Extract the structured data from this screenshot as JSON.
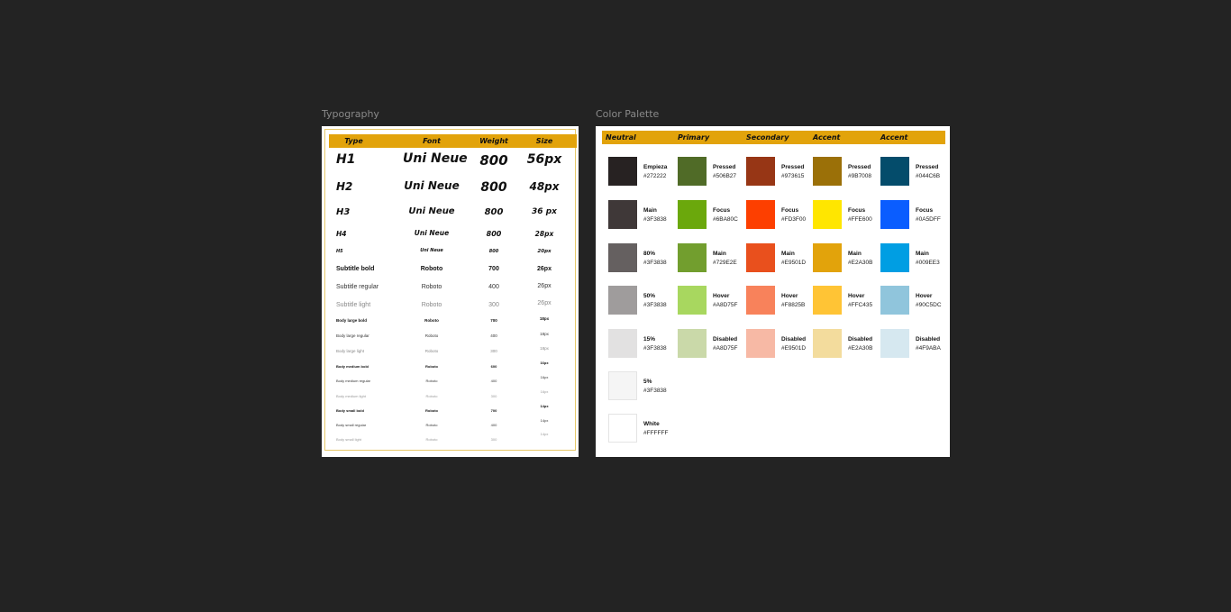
{
  "typography": {
    "frame_label": "Typography",
    "headers": [
      "Type",
      "Font",
      "Weight",
      "Size"
    ],
    "rows": [
      {
        "type": "H1",
        "font": "Uni Neue",
        "weight": "800",
        "size": "56px"
      },
      {
        "type": "H2",
        "font": "Uni Neue",
        "weight": "800",
        "size": "48px"
      },
      {
        "type": "H3",
        "font": "Uni Neue",
        "weight": "800",
        "size": "36 px"
      },
      {
        "type": "H4",
        "font": "Uni Neue",
        "weight": "800",
        "size": "28px"
      },
      {
        "type": "H5",
        "font": "Uni Neue",
        "weight": "800",
        "size": "20px"
      },
      {
        "type": "Subtitle bold",
        "font": "Roboto",
        "weight": "700",
        "size": "26px"
      },
      {
        "type": "Subtitle regular",
        "font": "Roboto",
        "weight": "400",
        "size": "26px"
      },
      {
        "type": "Subtitle light",
        "font": "Roboto",
        "weight": "300",
        "size": "26px"
      },
      {
        "type": "Body large bold",
        "font": "Roboto",
        "weight": "700",
        "size": "18px"
      },
      {
        "type": "Body large regular",
        "font": "Roboto",
        "weight": "400",
        "size": "18px"
      },
      {
        "type": "Body large light",
        "font": "Roboto",
        "weight": "300",
        "size": "18px"
      },
      {
        "type": "Body medium bold",
        "font": "Roboto",
        "weight": "600",
        "size": "16px"
      },
      {
        "type": "Body medium regular",
        "font": "Roboto",
        "weight": "400",
        "size": "16px"
      },
      {
        "type": "Body medium light",
        "font": "Roboto",
        "weight": "300",
        "size": "16px"
      },
      {
        "type": "Body small bold",
        "font": "Roboto",
        "weight": "700",
        "size": "14px"
      },
      {
        "type": "Body small regular",
        "font": "Roboto",
        "weight": "400",
        "size": "14px"
      },
      {
        "type": "Body small light",
        "font": "Roboto",
        "weight": "300",
        "size": "14px"
      }
    ]
  },
  "palette": {
    "frame_label": "Color Palette",
    "header_color": "#E2A30B",
    "columns": [
      {
        "title": "Neutral",
        "swatches": [
          {
            "name": "Empieza",
            "hex": "#272222",
            "color": "#272222"
          },
          {
            "name": "Main",
            "hex": "#3F3838",
            "color": "#3F3838"
          },
          {
            "name": "80%",
            "hex": "#3F3838",
            "color": "#656060"
          },
          {
            "name": "50%",
            "hex": "#3F3838",
            "color": "#9F9C9C"
          },
          {
            "name": "15%",
            "hex": "#3F3838",
            "color": "#E2E1E1"
          },
          {
            "name": "5%",
            "hex": "#3F3838",
            "color": "#F5F5F5"
          },
          {
            "name": "White",
            "hex": "#FFFFFF",
            "color": "#FFFFFF"
          }
        ]
      },
      {
        "title": "Primary",
        "swatches": [
          {
            "name": "Pressed",
            "hex": "#506B27",
            "color": "#506B27"
          },
          {
            "name": "Focus",
            "hex": "#6BA80C",
            "color": "#6BA80C"
          },
          {
            "name": "Main",
            "hex": "#729E2E",
            "color": "#729E2E"
          },
          {
            "name": "Hover",
            "hex": "#A8D75F",
            "color": "#A8D75F"
          },
          {
            "name": "Disabled",
            "hex": "#A8D75F",
            "color": "#CAD9A9"
          }
        ]
      },
      {
        "title": "Secondary",
        "swatches": [
          {
            "name": "Pressed",
            "hex": "#973615",
            "color": "#973615"
          },
          {
            "name": "Focus",
            "hex": "#FD3F00",
            "color": "#FD3F00"
          },
          {
            "name": "Main",
            "hex": "#E9501D",
            "color": "#E9501D"
          },
          {
            "name": "Hover",
            "hex": "#F8825B",
            "color": "#F8825B"
          },
          {
            "name": "Disabled",
            "hex": "#E9501D",
            "color": "#F7B9A5"
          }
        ]
      },
      {
        "title": "Accent",
        "swatches": [
          {
            "name": "Pressed",
            "hex": "#9B7008",
            "color": "#9B7008"
          },
          {
            "name": "Focus",
            "hex": "#FFE600",
            "color": "#FFE600"
          },
          {
            "name": "Main",
            "hex": "#E2A30B",
            "color": "#E2A30B"
          },
          {
            "name": "Hover",
            "hex": "#FFC435",
            "color": "#FFC435"
          },
          {
            "name": "Disabled",
            "hex": "#E2A30B",
            "color": "#F3DC9D"
          }
        ]
      },
      {
        "title": "Accent",
        "swatches": [
          {
            "name": "Pressed",
            "hex": "#044C6B",
            "color": "#044C6B"
          },
          {
            "name": "Focus",
            "hex": "#0A5DFF",
            "color": "#0A5DFF"
          },
          {
            "name": "Main",
            "hex": "#009EE3",
            "color": "#009EE3"
          },
          {
            "name": "Hover",
            "hex": "#90C5DC",
            "color": "#90C5DC"
          },
          {
            "name": "Disabled",
            "hex": "#4F9ABA",
            "color": "#D6E8F0"
          }
        ]
      }
    ]
  }
}
